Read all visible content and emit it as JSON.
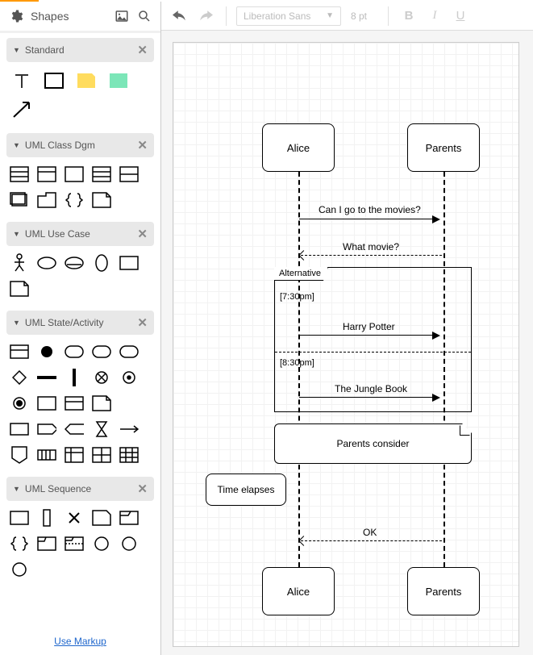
{
  "sidebar": {
    "title": "Shapes",
    "panels": [
      {
        "label": "Standard"
      },
      {
        "label": "UML Class Dgm"
      },
      {
        "label": "UML Use Case"
      },
      {
        "label": "UML State/Activity"
      },
      {
        "label": "UML Sequence"
      }
    ],
    "use_markup": "Use Markup"
  },
  "toolbar": {
    "font_name": "Liberation Sans",
    "font_size": "8 pt",
    "bold": "B",
    "italic": "I",
    "underline": "U"
  },
  "diagram": {
    "lifelines": [
      {
        "name": "Alice"
      },
      {
        "name": "Parents"
      }
    ],
    "messages": {
      "m1": "Can I go to the movies?",
      "m2": "What movie?",
      "m3": "Harry Potter",
      "m4": "The Jungle Book",
      "m5": "OK"
    },
    "fragment": {
      "label": "Alternative",
      "guard1": "[7:30pm]",
      "guard2": "[8:30pm]"
    },
    "consider_note": "Parents consider",
    "elapse_note": "Time elapses",
    "bottom": [
      {
        "name": "Alice"
      },
      {
        "name": "Parents"
      }
    ]
  }
}
